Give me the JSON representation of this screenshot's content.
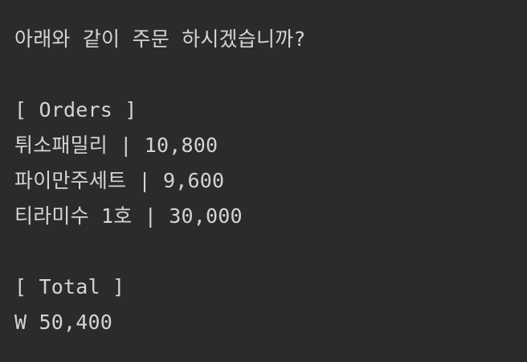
{
  "console": {
    "prompt": "아래와 같이 주문 하시겠습니까?",
    "orders_header": "[ Orders ]",
    "orders": [
      "튀소패밀리 | 10,800",
      "파이만주세트 | 9,600",
      "티라미수 1호 | 30,000"
    ],
    "total_header": "[ Total ]",
    "total": "W 50,400"
  }
}
